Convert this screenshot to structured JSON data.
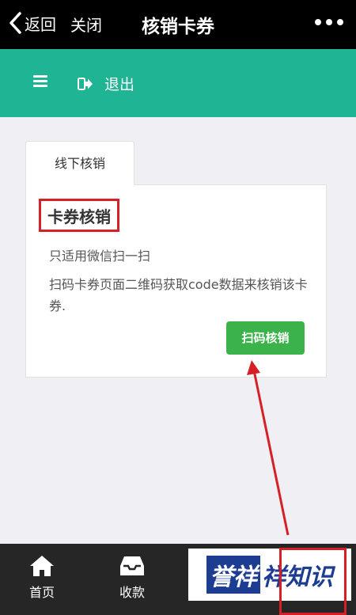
{
  "header": {
    "back_label": "返回",
    "close_label": "关闭",
    "title": "核销卡券"
  },
  "nav": {
    "logout_label": "退出"
  },
  "tabs": [
    {
      "label": "线下核销",
      "active": true
    }
  ],
  "card": {
    "title": "卡券核销",
    "subtitle": "只适用微信扫一扫",
    "description": "扫码卡券页面二维码获取code数据来核销该卡券.",
    "button_label": "扫码核销"
  },
  "bottom_nav": [
    {
      "label": "首页",
      "icon": "home-icon"
    },
    {
      "label": "收款",
      "icon": "inbox-icon"
    }
  ],
  "watermark": {
    "badge": "誉祥",
    "text": "祥知识"
  },
  "colors": {
    "nav_teal": "#1fb494",
    "button_green": "#3cb34a",
    "highlight_red": "#d42026",
    "bottom_bar": "#262626"
  }
}
